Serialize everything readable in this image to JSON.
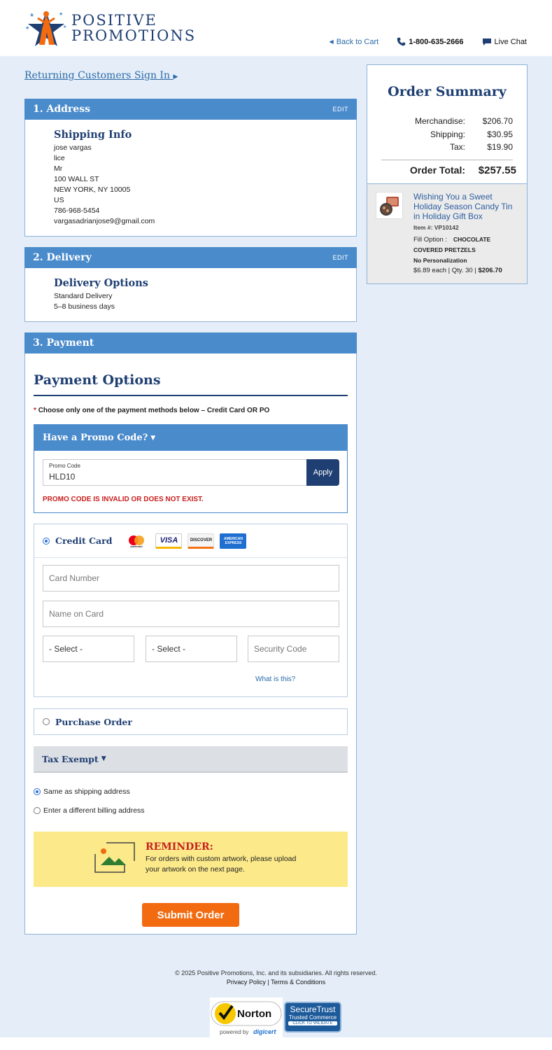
{
  "header": {
    "logo_line1": "POSITIVE",
    "logo_line2": "PROMOTIONS",
    "back_to_cart": "Back to Cart",
    "phone": "1-800-635-2666",
    "live_chat": "Live Chat"
  },
  "signin": {
    "label": "Returning Customers Sign In"
  },
  "address": {
    "heading": "1. Address",
    "edit": "EDIT",
    "title": "Shipping Info",
    "lines": [
      "jose vargas",
      "lice",
      "Mr",
      "100 WALL ST",
      "NEW YORK, NY 10005",
      "US",
      "786-968-5454",
      "vargasadrianjose9@gmail.com"
    ]
  },
  "delivery": {
    "heading": "2. Delivery",
    "edit": "EDIT",
    "title": "Delivery Options",
    "method": "Standard Delivery",
    "timeframe": "5–8 business days"
  },
  "payment": {
    "heading": "3. Payment",
    "title": "Payment Options",
    "note": "Choose only one of the payment methods below – Credit Card OR PO",
    "promo": {
      "toggle": "Have a Promo Code?",
      "field_label": "Promo Code",
      "value": "HLD10",
      "apply": "Apply",
      "error": "PROMO CODE IS INVALID OR DOES NOT EXIST."
    },
    "credit_card": {
      "label": "Credit Card",
      "selected": true,
      "card_number_placeholder": "Card Number",
      "name_placeholder": "Name on Card",
      "month_select": "- Select -",
      "year_select": "- Select -",
      "security_placeholder": "Security Code",
      "what_is_this": "What is this?",
      "brands": [
        "mastercard",
        "VISA",
        "DISCOVER",
        "AMERICAN EXPRESS"
      ]
    },
    "purchase_order": {
      "label": "Purchase Order",
      "selected": false
    },
    "tax_exempt": {
      "label": "Tax Exempt"
    },
    "billing": {
      "same": "Same as shipping address",
      "different": "Enter a different billing address",
      "selected": "same"
    },
    "reminder": {
      "title": "REMINDER:",
      "text": "For orders with custom artwork, please upload your artwork on the next page."
    },
    "submit": "Submit Order"
  },
  "summary": {
    "title": "Order Summary",
    "merch_label": "Merchandise:",
    "merch_value": "$206.70",
    "ship_label": "Shipping:",
    "ship_value": "$30.95",
    "tax_label": "Tax:",
    "tax_value": "$19.90",
    "total_label": "Order Total:",
    "total_value": "$257.55",
    "item": {
      "name": "Wishing You a Sweet Holiday Season Candy Tin in Holiday Gift Box",
      "item_no": "Item #: VP10142",
      "fill_label": "Fill Option :",
      "fill_value": "CHOCOLATE COVERED PRETZELS",
      "personalization": "No Personalization",
      "price_each": "$6.89 each | Qty. 30 |",
      "line_total": "$206.70"
    }
  },
  "footer": {
    "copyright": "© 2025 Positive Promotions, Inc. and its subsidiaries. All rights reserved.",
    "privacy": "Privacy Policy",
    "separator": "|",
    "terms": "Terms & Conditions",
    "norton_label": "Norton",
    "norton_sub": "powered by",
    "norton_digicert": "digicert",
    "securetrust_1": "SecureTrust",
    "securetrust_2": "Trusted Commerce",
    "securetrust_3": "CLICK TO VALIDATE"
  },
  "colors": {
    "navy": "#1f3f73",
    "section_blue": "#4a8bcc",
    "page_bg": "#e5eef8",
    "error_red": "#c8201e",
    "submit_orange": "#f26b10",
    "reminder_yellow": "#fbe98a"
  }
}
